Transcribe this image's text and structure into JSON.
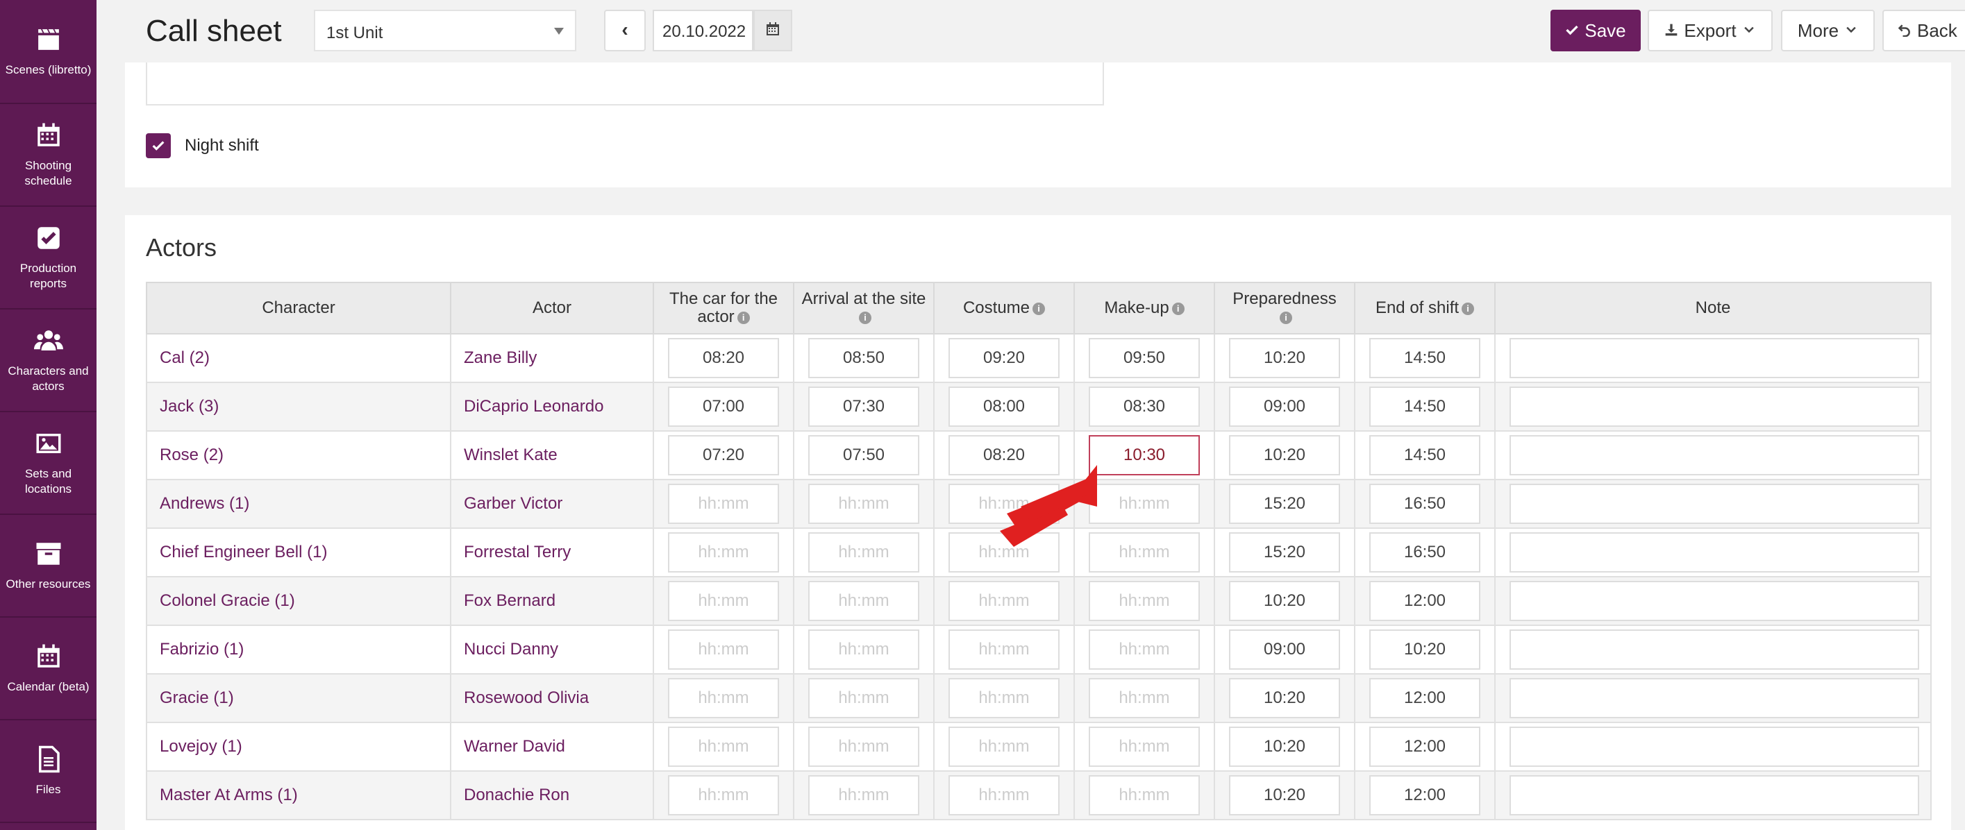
{
  "sidebar": {
    "items": [
      {
        "label": "Scenes (libretto)",
        "icon": "clapperboard-icon"
      },
      {
        "label": "Shooting schedule",
        "icon": "calendar-icon"
      },
      {
        "label": "Production reports",
        "icon": "checkbox-icon"
      },
      {
        "label": "Characters and actors",
        "icon": "users-icon"
      },
      {
        "label": "Sets and locations",
        "icon": "image-icon"
      },
      {
        "label": "Other resources",
        "icon": "archive-icon"
      },
      {
        "label": "Calendar (beta)",
        "icon": "calendar-grid-icon"
      },
      {
        "label": "Files",
        "icon": "file-icon"
      }
    ]
  },
  "header": {
    "title": "Call sheet",
    "unit": "1st Unit",
    "prev": "‹",
    "date": "20.10.2022",
    "save": "Save",
    "export": "Export",
    "more": "More",
    "back": "Back"
  },
  "top": {
    "night_shift": "Night shift",
    "night_shift_checked": true
  },
  "actors": {
    "title": "Actors",
    "columns": [
      "Character",
      "Actor",
      "The car for the actor",
      "Arrival at the site",
      "Costume",
      "Make-up",
      "Preparedness",
      "End of shift",
      "Note"
    ],
    "placeholder": "hh:mm",
    "rows": [
      {
        "character": "Cal (2)",
        "actor": "Zane Billy",
        "times": [
          "08:20",
          "08:50",
          "09:20",
          "09:50",
          "10:20",
          "14:50"
        ]
      },
      {
        "character": "Jack (3)",
        "actor": "DiCaprio Leonardo",
        "times": [
          "07:00",
          "07:30",
          "08:00",
          "08:30",
          "09:00",
          "14:50"
        ]
      },
      {
        "character": "Rose (2)",
        "actor": "Winslet Kate",
        "times": [
          "07:20",
          "07:50",
          "08:20",
          "10:30",
          "10:20",
          "14:50"
        ]
      },
      {
        "character": "Andrews (1)",
        "actor": "Garber Victor",
        "times": [
          "",
          "",
          "",
          "",
          "15:20",
          "16:50"
        ]
      },
      {
        "character": "Chief Engineer Bell (1)",
        "actor": "Forrestal Terry",
        "times": [
          "",
          "",
          "",
          "",
          "15:20",
          "16:50"
        ]
      },
      {
        "character": "Colonel Gracie (1)",
        "actor": "Fox Bernard",
        "times": [
          "",
          "",
          "",
          "",
          "10:20",
          "12:00"
        ]
      },
      {
        "character": "Fabrizio (1)",
        "actor": "Nucci Danny",
        "times": [
          "",
          "",
          "",
          "",
          "09:00",
          "10:20"
        ]
      },
      {
        "character": "Gracie (1)",
        "actor": "Rosewood Olivia",
        "times": [
          "",
          "",
          "",
          "",
          "10:20",
          "12:00"
        ]
      },
      {
        "character": "Lovejoy (1)",
        "actor": "Warner David",
        "times": [
          "",
          "",
          "",
          "",
          "10:20",
          "12:00"
        ]
      },
      {
        "character": "Master At Arms (1)",
        "actor": "Donachie Ron",
        "times": [
          "",
          "",
          "",
          "",
          "10:20",
          "12:00"
        ]
      }
    ]
  }
}
